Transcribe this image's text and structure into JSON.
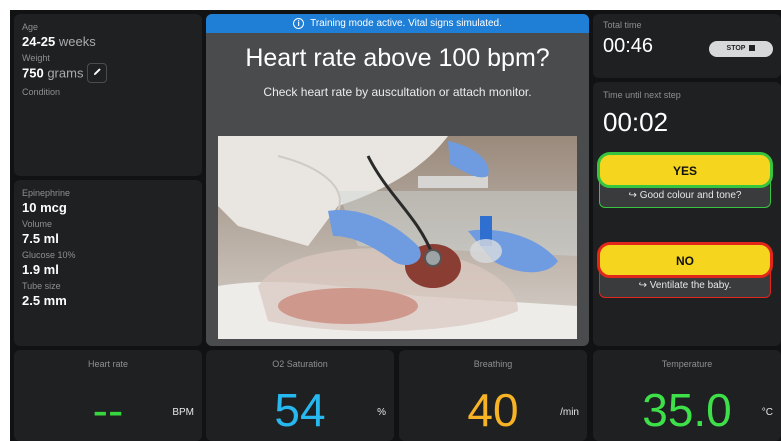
{
  "patient": {
    "age_label": "Age",
    "age_value": "24-25",
    "age_unit": "weeks",
    "weight_label": "Weight",
    "weight_value": "750",
    "weight_unit": "grams",
    "edit_icon": "pencil-icon",
    "condition_label": "Condition"
  },
  "drugs": [
    {
      "label": "Epinephrine",
      "value": "10 mcg"
    },
    {
      "label": "Volume",
      "value": "7.5 ml"
    },
    {
      "label": "Glucose 10%",
      "value": "1.9 ml"
    },
    {
      "label": "Tube size",
      "value": "2.5 mm"
    }
  ],
  "banner": {
    "text": "Training mode active. Vital signs simulated.",
    "icon": "info-icon",
    "color": "#1f7fd6"
  },
  "step": {
    "question": "Heart rate above 100 bpm?",
    "instruction": "Check heart rate by auscultation or attach monitor."
  },
  "timer": {
    "total_label": "Total time",
    "total_value": "00:46",
    "stop_label": "STOP",
    "next_label": "Time until next step",
    "next_value": "00:02"
  },
  "choices": {
    "yes_label": "YES",
    "yes_next": "↪  Good colour and tone?",
    "no_label": "NO",
    "no_next": "↪  Ventilate the baby."
  },
  "vitals": {
    "heart_rate": {
      "label": "Heart rate",
      "value": "--",
      "unit": "BPM",
      "color": "#37d63e"
    },
    "o2": {
      "label": "O2 Saturation",
      "value": "54",
      "unit": "%",
      "color": "#27b8f0"
    },
    "breathing": {
      "label": "Breathing",
      "value": "40",
      "unit": "/min",
      "color": "#f5b325"
    },
    "temperature": {
      "label": "Temperature",
      "value": "35.0",
      "unit": "°C",
      "color": "#3ee04a"
    }
  }
}
